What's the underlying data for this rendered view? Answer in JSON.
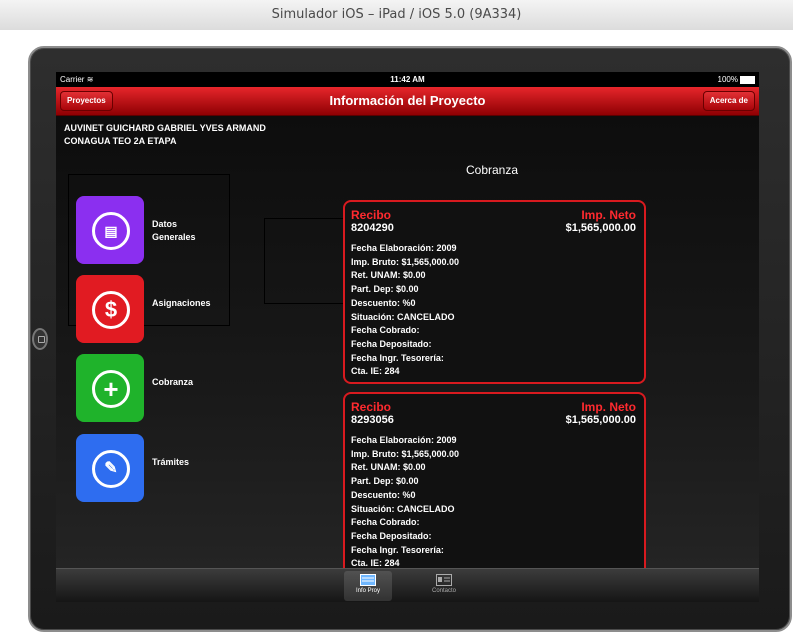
{
  "window": {
    "title": "Simulador iOS – iPad / iOS 5.0 (9A334)"
  },
  "statusbar": {
    "carrier": "Carrier",
    "time": "11:42 AM",
    "battery": "100%"
  },
  "navbar": {
    "title": "Información del Proyecto",
    "left_button": "Proyectos",
    "right_button": "Acerca de"
  },
  "header": {
    "line1": "AUVINET GUICHARD GABRIEL YVES ARMAND",
    "line2": "CONAGUA TEO 2A ETAPA"
  },
  "section_title": "Cobranza",
  "menu": [
    {
      "label_line1": "Datos",
      "label_line2": "Generales",
      "color": "#8b2ff0",
      "icon": "clipboard-icon"
    },
    {
      "label_line1": "Asignaciones",
      "label_line2": "",
      "color": "#e11b22",
      "icon": "dollar-icon"
    },
    {
      "label_line1": "Cobranza",
      "label_line2": "",
      "color": "#1fb32b",
      "icon": "plus-icon"
    },
    {
      "label_line1": "Trámites",
      "label_line2": "",
      "color": "#2e6df0",
      "icon": "pencil-icon"
    }
  ],
  "cards": [
    {
      "recibo_label": "Recibo",
      "recibo_num": "8204290",
      "imp_label": "Imp. Neto",
      "imp_value": "$1,565,000.00",
      "fecha_elaboracion": "Fecha Elaboración: 2009",
      "imp_bruto": "Imp. Bruto: $1,565,000.00",
      "ret_unam": "Ret. UNAM: $0.00",
      "part_dep": "Part. Dep: $0.00",
      "descuento": "Descuento: %0",
      "situacion": "Situación: CANCELADO",
      "fecha_cobrado": "Fecha Cobrado:",
      "fecha_depositado": "Fecha Depositado:",
      "fecha_ingr": "Fecha Ingr. Tesorería:",
      "cta_ie": "Cta. IE: 284"
    },
    {
      "recibo_label": "Recibo",
      "recibo_num": "8293056",
      "imp_label": "Imp. Neto",
      "imp_value": "$1,565,000.00",
      "fecha_elaboracion": "Fecha Elaboración: 2009",
      "imp_bruto": "Imp. Bruto: $1,565,000.00",
      "ret_unam": "Ret. UNAM: $0.00",
      "part_dep": "Part. Dep: $0.00",
      "descuento": "Descuento: %0",
      "situacion": "Situación: CANCELADO",
      "fecha_cobrado": "Fecha Cobrado:",
      "fecha_depositado": "Fecha Depositado:",
      "fecha_ingr": "Fecha Ingr. Tesorería:",
      "cta_ie": "Cta. IE: 284"
    }
  ],
  "tabbar": [
    {
      "label": "Info Proy",
      "icon": "info-proy-icon"
    },
    {
      "label": "Contacto",
      "icon": "contact-card-icon"
    }
  ]
}
